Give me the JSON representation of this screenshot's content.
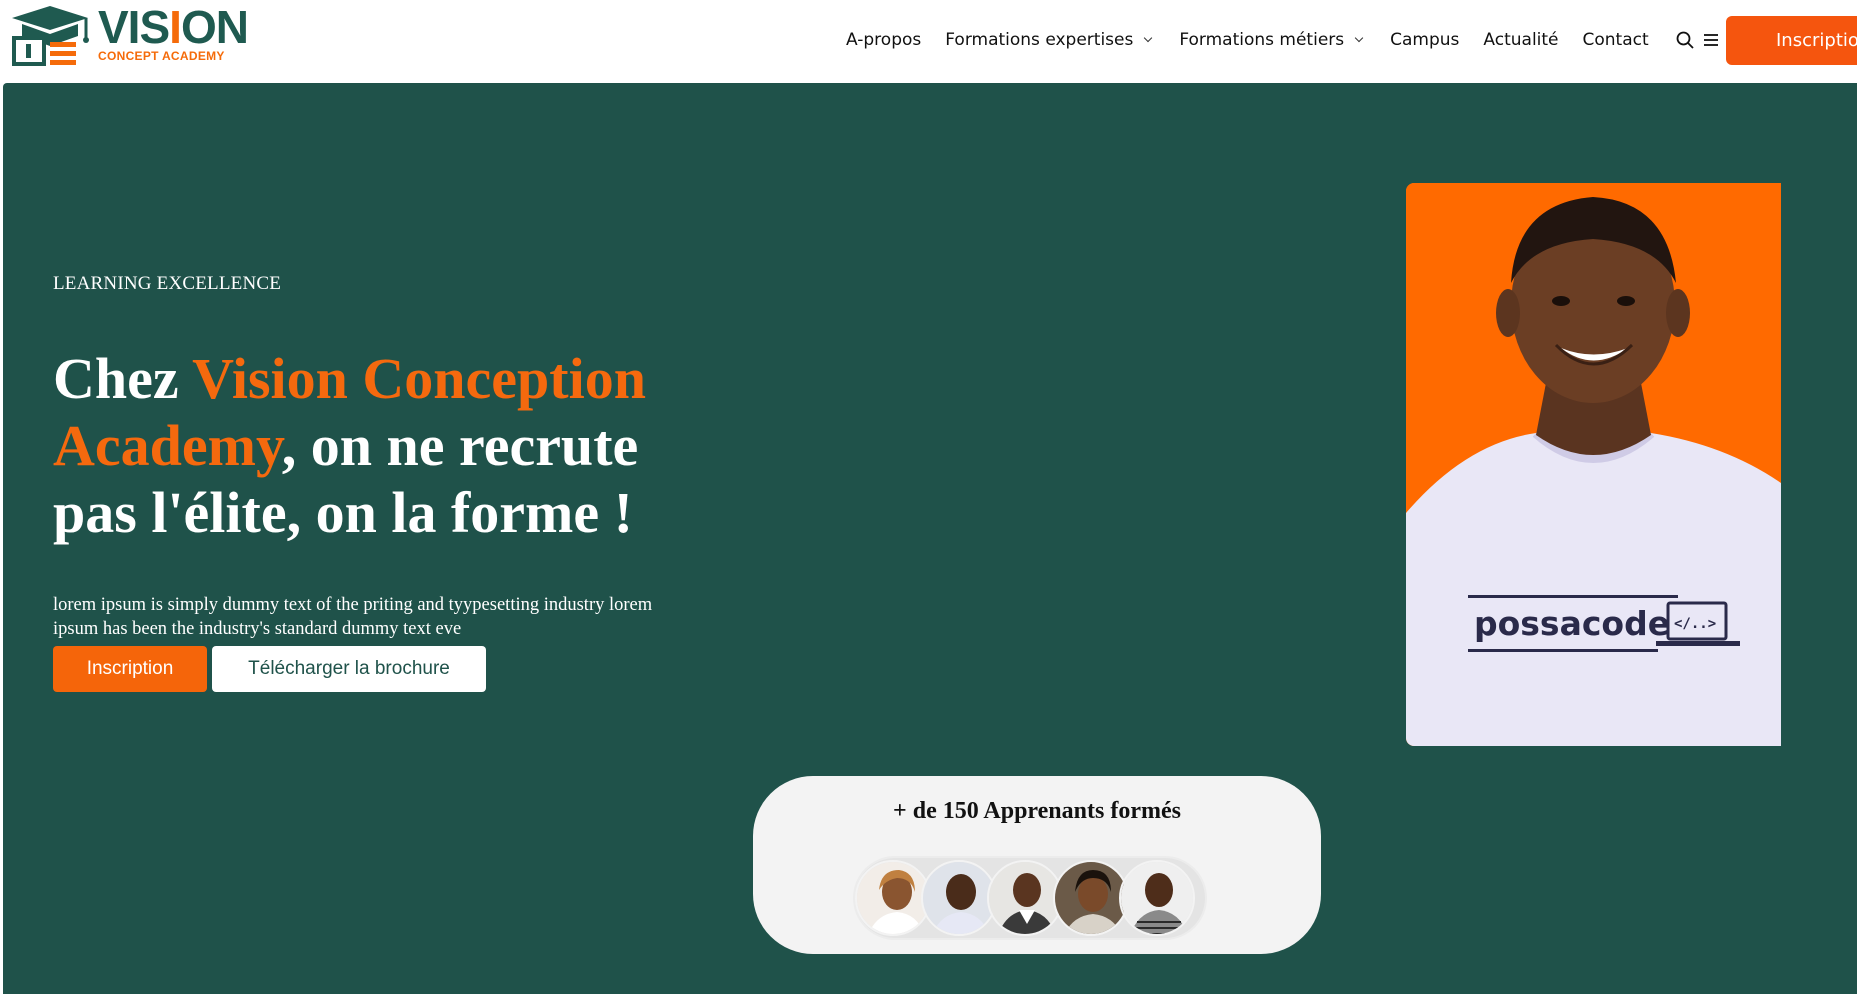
{
  "brand": {
    "name_part1": "VIS",
    "name_dot": "I",
    "name_part2": "ON",
    "subtitle": "CONCEPT ACADEMY",
    "colors": {
      "primary_green": "#1f524a",
      "accent_orange": "#f5650a"
    }
  },
  "nav": {
    "items": [
      {
        "label": "A-propos"
      },
      {
        "label": "Formations expertises",
        "has_dropdown": true
      },
      {
        "label": "Formations métiers",
        "has_dropdown": true
      },
      {
        "label": "Campus"
      },
      {
        "label": "Actualité"
      },
      {
        "label": "Contact"
      }
    ],
    "icons": [
      "search-icon",
      "menu-icon"
    ],
    "cta_label": "Inscription"
  },
  "hero": {
    "eyebrow": "LEARNING EXCELLENCE",
    "headline_prefix": "Chez ",
    "headline_accent": "Vision Conception Academy",
    "headline_suffix": ", on ne recrute pas l'élite, on la forme !",
    "description": "lorem ipsum is simply dummy text of the priting and tyypesetting industry lorem ipsum has been the industry's standard dummy text eve",
    "primary_button": "Inscription",
    "secondary_button": "Télécharger la brochure",
    "portrait_shirt_text": "possacode",
    "portrait_shirt_badge": "</..>"
  },
  "learners": {
    "title": "+ de 150 Apprenants formés",
    "avatar_count": 5
  }
}
